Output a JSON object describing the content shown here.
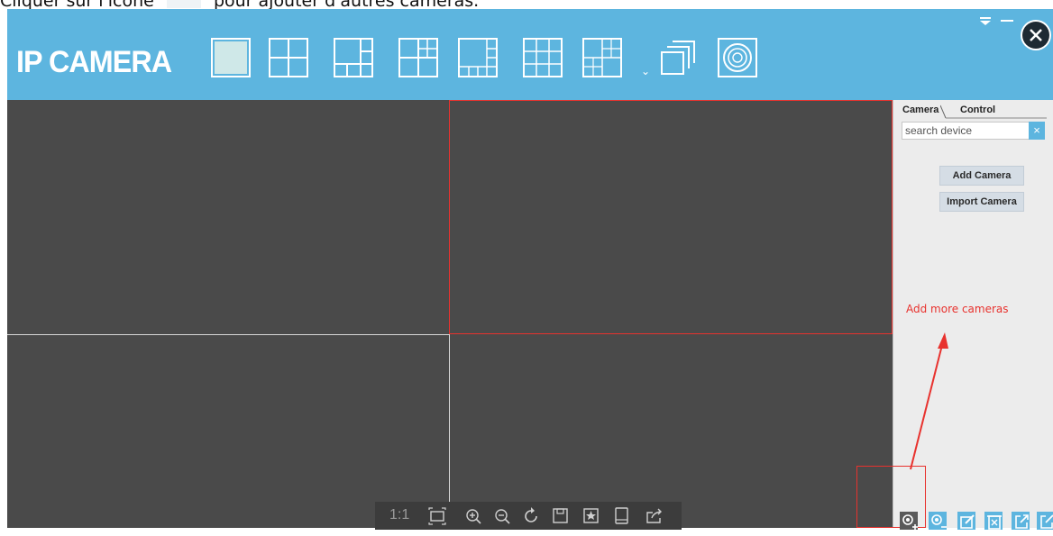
{
  "caption": {
    "before": "Cliquer sur l'icône",
    "after": "pour ajouter d'autres caméras."
  },
  "app": {
    "logo": "IP CAMERA",
    "layout_buttons": [
      {
        "icon": "layout-1-icon"
      },
      {
        "icon": "layout-4-icon"
      },
      {
        "icon": "layout-6-icon"
      },
      {
        "icon": "layout-8-icon"
      },
      {
        "icon": "layout-9-icon"
      },
      {
        "icon": "layout-9b-icon"
      },
      {
        "icon": "layout-13-icon"
      }
    ],
    "extra_buttons": [
      {
        "icon": "multi-window-icon"
      },
      {
        "icon": "camera-lens-icon"
      }
    ],
    "window_controls": {
      "menu_icon": "menu-down-icon",
      "minimize_icon": "minimize-icon",
      "close_icon": "close-icon"
    }
  },
  "side_panel": {
    "tabs": [
      {
        "label": "Camera"
      },
      {
        "label": "Control"
      }
    ],
    "search": {
      "value": "search device",
      "clear_icon": "clear-icon"
    },
    "buttons": {
      "add_camera": "Add Camera",
      "import_camera": "Import Camera"
    },
    "bottom_icons": [
      "add-camera-icon",
      "remove-camera-icon",
      "edit-icon",
      "delete-icon",
      "export-icon",
      "import-icon"
    ]
  },
  "annotation": {
    "text": "Add more cameras",
    "color": "#e8322e"
  },
  "toolbar": {
    "ratio_label": "1:1",
    "icons": [
      "fit-screen-icon",
      "zoom-in-icon",
      "zoom-out-icon",
      "rotate-icon",
      "save-icon",
      "bookmark-icon",
      "tablet-icon",
      "share-icon"
    ]
  },
  "colors": {
    "header": "#5db5df",
    "video_bg": "#4a4a4a",
    "panel_bg": "#ececec",
    "accent_red": "#e8322e"
  }
}
